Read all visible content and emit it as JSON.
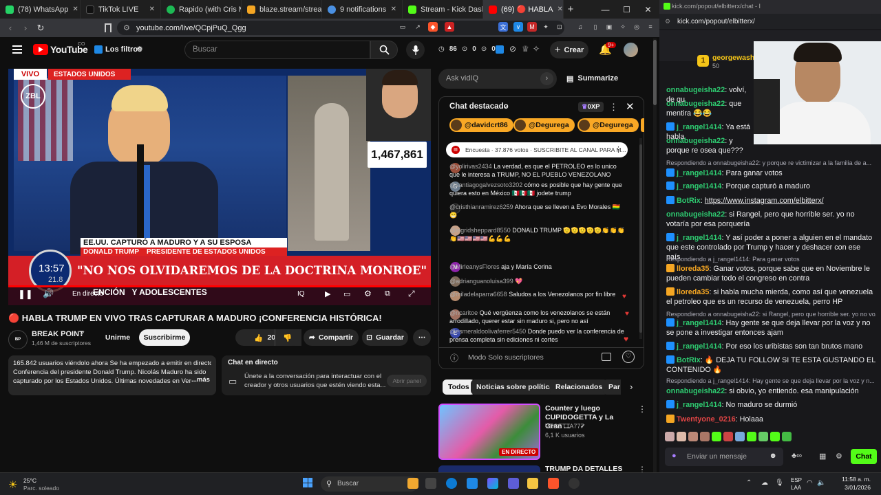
{
  "browser": {
    "tabs": [
      {
        "label": "(78) WhatsApp",
        "color": "#25d366"
      },
      {
        "label": "TikTok LIVE",
        "color": "#111111"
      },
      {
        "label": "Rapido (with Cris M",
        "color": "#1db954"
      },
      {
        "label": "blaze.stream/stream-se",
        "color": "#f5a623"
      },
      {
        "label": "9 notifications",
        "color": "#4a90e2"
      },
      {
        "label": "Stream - Kick Dashboar",
        "color": "#53fc18"
      },
      {
        "label": "(69) 🔴 HABLA",
        "color": "#ff0000"
      }
    ],
    "url": "youtube.com/live/QCpjPuQ_Qgg",
    "popout_url_title": "kick.com/popout/elbitterx/chat - I",
    "popout_url": "kick.com/popout/elbitterx/"
  },
  "youtube": {
    "logo": "YouTube",
    "country": "CO",
    "filters_label": "Los filtros",
    "search_placeholder": "Buscar",
    "stats": {
      "a": "86",
      "b": "0",
      "c": "0"
    },
    "create_label": "Crear",
    "notif_count": "9+",
    "video": {
      "live_label": "VIVO",
      "location_label": "ESTADOS UNIDOS",
      "channel_wm": "ZBL",
      "viewer_overlay": "1,467,861",
      "lower_third_1": "EE.UU. CAPTURÓ A MADURO Y A SU ESPOSA",
      "lower_third_2": "DONALD TRUMP    PRESIDENTE DE ESTADOS UNIDOS",
      "quote": "\"NO NOS OLVIDAREMOS DE LA DOCTRINA MONROE\"",
      "ticker": "ENCIÓN   Y ADOLESCENTES",
      "clock": "13:57",
      "clock_sub": "21.8",
      "in_direct": "En directo"
    },
    "title": "🔴 HABLA TRUMP EN VIVO TRAS CAPTURAR A MADURO ¡CONFERENCIA HISTÓRICA!",
    "channel": {
      "name": "BREAK POINT",
      "subs": "1,46 M de suscriptores",
      "join": "Unirme",
      "subscribe": "Suscribirme"
    },
    "actions": {
      "likes": "20 K",
      "share": "Compartir",
      "save": "Guardar"
    },
    "description": {
      "line1": "165.842 usuarios viéndolo ahora  Se ha empezado a emitir en directo",
      "line2": "Conferencia del presidente Donald Trump. Nicolás Maduro ha sido",
      "line3": "capturado por los Estados Unidos. Últimas novedades en Ven",
      "more": "...más"
    },
    "live_chat_box": {
      "title": "Chat en directo",
      "text1": "Únete a la conversación para interactuar con el",
      "text2": "creador y otros usuarios que estén viendo esta...",
      "open": "Abrir panel"
    },
    "vidiq_placeholder": "Ask vidIQ",
    "summarize": "Summarize",
    "chat": {
      "header": "Chat destacado",
      "xp": "0XP",
      "pills": [
        "@davidcrt86",
        "@Degurega",
        "@Degurega"
      ],
      "poll": "Encuesta · 37.876 votos · SUSCRIBITE AL CANAL PARA M...",
      "messages": [
        {
          "user": "@yolirivas2434",
          "text": "La verdad, es que el PETROLEO es lo unico que le interesa a TRUMP, NO EL PUEBLO VENEZOLANO"
        },
        {
          "user": "@santiagogalvezsoto3202",
          "text": "cómo es posible que hay gente que quiera esto en México 🇲🇽🇲🇽🇲🇽 jodete trump"
        },
        {
          "user": "@cristhianramirez6259",
          "text": "Ahora que se lleven a Evo Morales 🇧🇴😁"
        },
        {
          "user": "@ingridsheppard8550",
          "text": "DONALD TRUMP 🫡🫡🫡🫡🫡👏👏👏👏🇺🇸🇺🇸🇺🇸🇺🇸💪💪💪"
        },
        {
          "user": "@MirleanysFlores",
          "text": "aja y María Corina"
        },
        {
          "user": "@adrianguanoluisa399",
          "text": "💖"
        },
        {
          "user": "@miladelaparra6658",
          "text": "Saludos a los Venezolanos por fin libre"
        },
        {
          "user": "@ncaritoe",
          "text": "Qué vergüenza como los venezolanos se están arrodillado, querer estar sin maduro si, pero no así"
        },
        {
          "user": "@esmeraldoolivaferrer5450",
          "text": "Donde puedo ver la conferencia de prensa completa sin ediciones ni cortes"
        }
      ],
      "mode": "Modo Solo suscriptores"
    },
    "chips": [
      "Todos",
      "Noticias sobre política",
      "Relacionados",
      "Par"
    ],
    "rec": [
      {
        "title": "Counter y luego CUPIDOGETTA y La Gran ...",
        "channel": "VEGETTA777",
        "meta": "6,1 K usuarios",
        "badge": "EN DIRECTO"
      },
      {
        "title": "TRUMP DA DETALLES DE LA",
        "channel": "",
        "meta": "",
        "badge": ""
      }
    ]
  },
  "kick": {
    "top_user": "georgewasht",
    "top_rank": "1",
    "top_points": "50",
    "messages": [
      {
        "user": "onnabugeisha22",
        "text": "volví, de qu",
        "cls": "",
        "reply": ""
      },
      {
        "user": "onnabugeisha22",
        "text": "que mentira 😂😂",
        "cls": "",
        "reply": ""
      },
      {
        "user": "j_rangel1414",
        "text": "Ya está habla",
        "cls": "",
        "reply": ""
      },
      {
        "user": "onnabugeisha22",
        "text": "y porque re osea que???",
        "cls": "",
        "reply": ""
      },
      {
        "user": "j_rangel1414",
        "text": "Para ganar votos",
        "cls": "",
        "reply": "Respondiendo a onnabugeisha22: y porque re victimizar a la familia de a..."
      },
      {
        "user": "j_rangel1414",
        "text": "Porque capturó a maduro",
        "cls": "",
        "reply": ""
      },
      {
        "user": "BotRix",
        "text": "https://www.instagram.com/elbitterx/",
        "cls": "",
        "reply": ""
      },
      {
        "user": "onnabugeisha22",
        "text": "si Rangel, pero que horrible ser. yo no votaría por esa porquería",
        "cls": "",
        "reply": ""
      },
      {
        "user": "j_rangel1414",
        "text": "Y así poder a poner a alguien en el mandato que este controlado por Trump y hacer y deshacer con ese país",
        "cls": "",
        "reply": ""
      },
      {
        "user": "lloreda35",
        "text": "Ganar votos, porque sabe que en Noviembre le pueden cambiar todo el congreso en contra",
        "cls": "o",
        "reply": "Respondiendo a j_rangel1414: Para ganar votos"
      },
      {
        "user": "lloreda35",
        "text": "si habla mucha mierda, como así que venezuela el petroleo que es un recurso de venezuela, perro HP",
        "cls": "o",
        "reply": ""
      },
      {
        "user": "j_rangel1414",
        "text": "Hay gente se que deja llevar por la voz y no se pone a investigar entonces ajam",
        "cls": "",
        "reply": "Respondiendo a onnabugeisha22: si Rangel, pero que horrible ser. yo no vo..."
      },
      {
        "user": "j_rangel1414",
        "text": "Por eso los uribistas son tan brutos mano",
        "cls": "",
        "reply": ""
      },
      {
        "user": "BotRix",
        "text": "🔥 DEJA TU FOLLOW SI TE ESTA GUSTANDO EL CONTENIDO 🔥",
        "cls": "",
        "reply": ""
      },
      {
        "user": "onnabugeisha22",
        "text": "si obvio, yo entiendo. esa manipulación",
        "cls": "",
        "reply": "Respondiendo a j_rangel1414: Hay gente se que deja llevar por la voz y n..."
      },
      {
        "user": "j_rangel1414",
        "text": "No maduro se durmió",
        "cls": "",
        "reply": ""
      },
      {
        "user": "Twentyone_0216",
        "text": "Holaaa",
        "cls": "r",
        "reply": ""
      }
    ],
    "input_placeholder": "Enviar un mensaje",
    "chat_button": "Chat"
  },
  "taskbar": {
    "weather_temp": "25°C",
    "weather_desc": "Parc. soleado",
    "search": "Buscar",
    "lang1": "ESP",
    "lang2": "LAA",
    "time": "11:58 a. m.",
    "date": "3/01/2026"
  }
}
